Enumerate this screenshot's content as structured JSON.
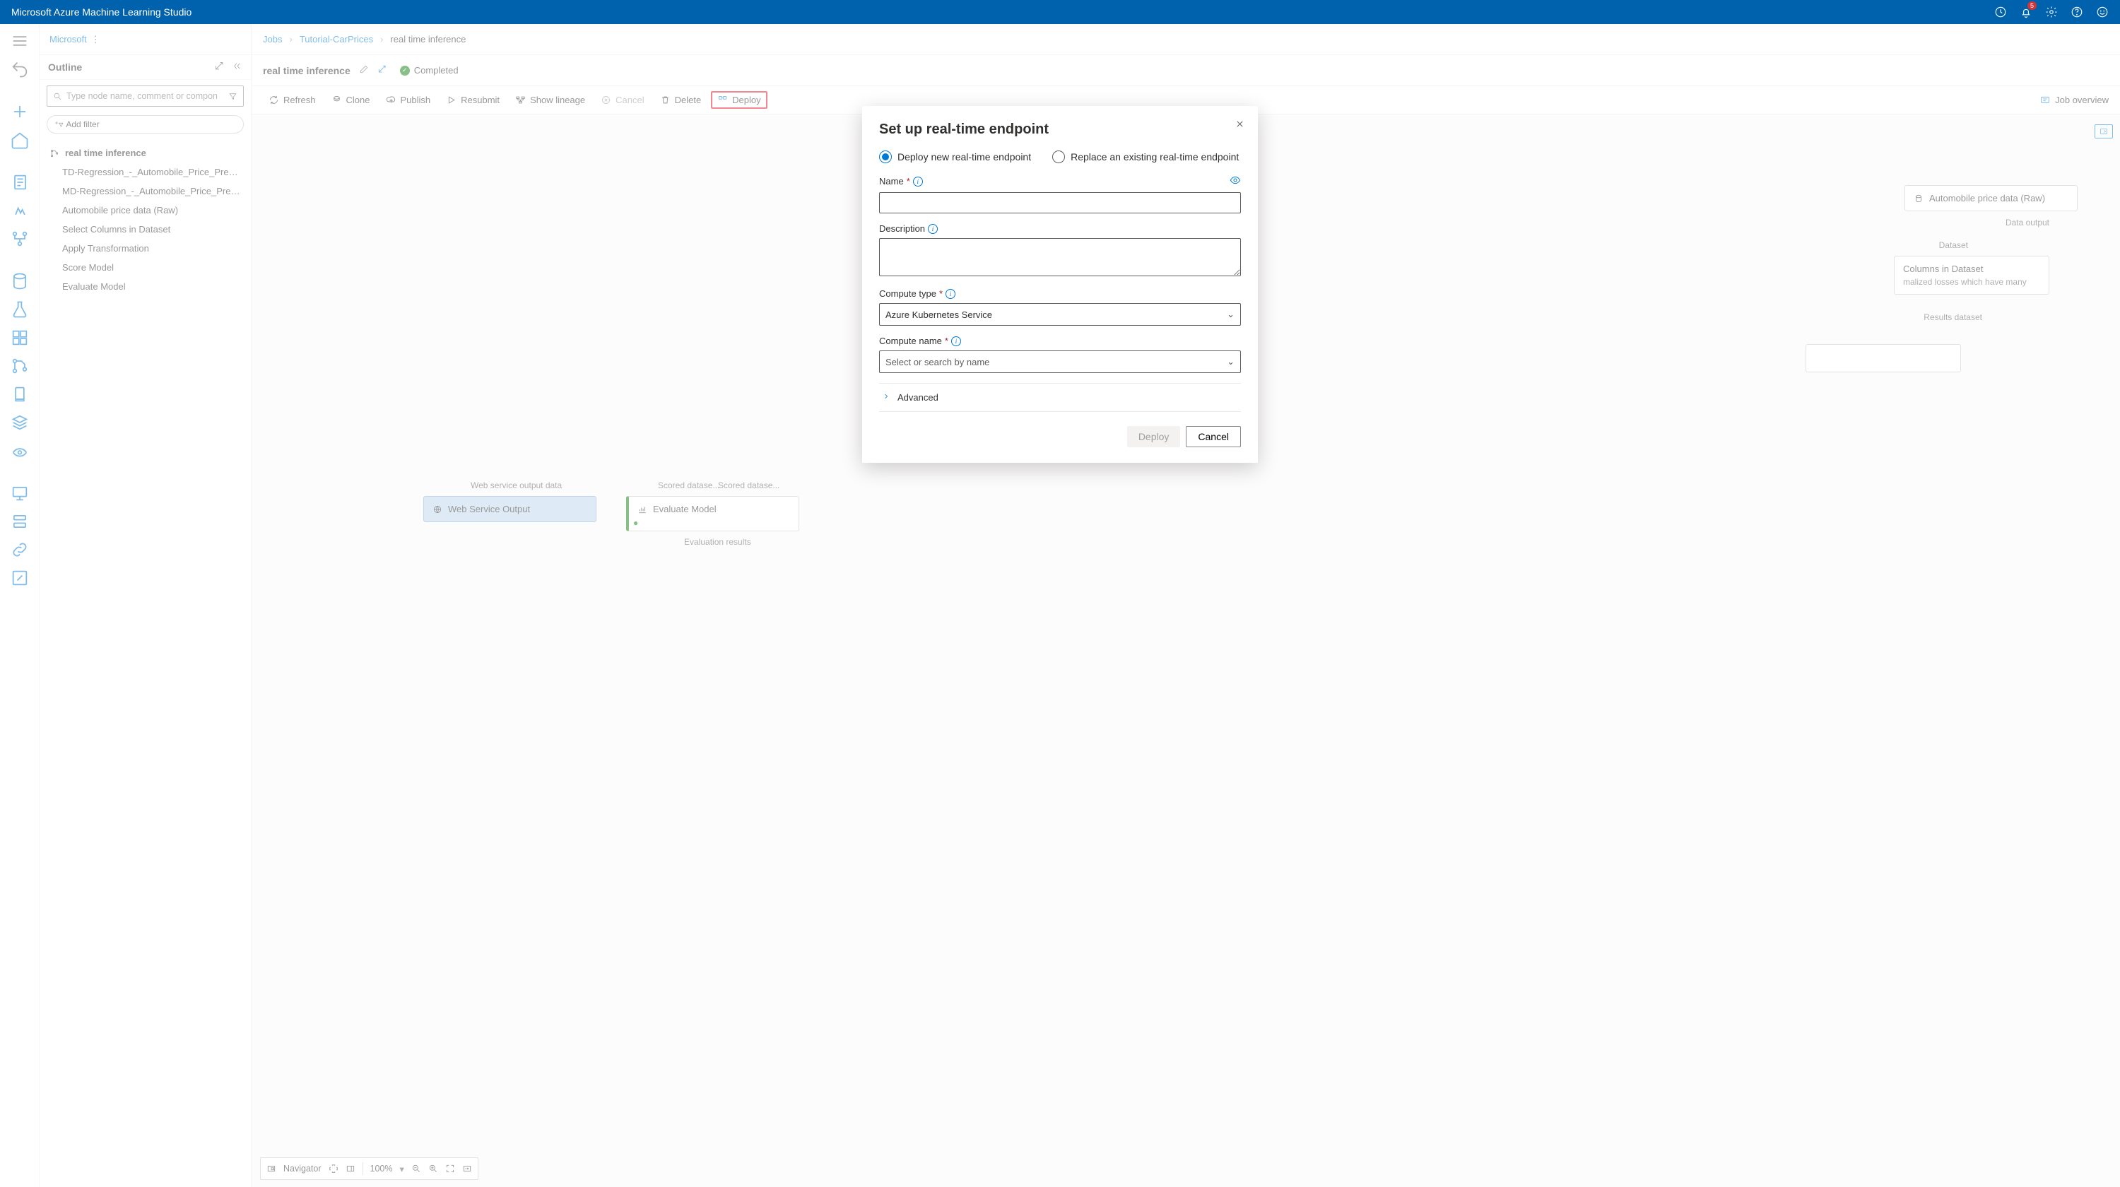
{
  "app_title": "Microsoft Azure Machine Learning Studio",
  "notifications_count": "5",
  "breadcrumb_local": {
    "root": "Microsoft",
    "after": " ⋮"
  },
  "outline": {
    "title": "Outline",
    "search_placeholder": "Type node name, comment or compon",
    "add_filter": "Add filter",
    "root": "real time inference",
    "items": [
      "TD-Regression_-_Automobile_Price_Predict...",
      "MD-Regression_-_Automobile_Price_Predic...",
      "Automobile price data (Raw)",
      "Select Columns in Dataset",
      "Apply Transformation",
      "Score Model",
      "Evaluate Model"
    ]
  },
  "main_breadcrumb": {
    "a": "Jobs",
    "b": "Tutorial-CarPrices",
    "c": "real time inference"
  },
  "job": {
    "name": "real time inference",
    "status": "Completed"
  },
  "toolbar": {
    "refresh": "Refresh",
    "clone": "Clone",
    "publish": "Publish",
    "resubmit": "Resubmit",
    "show_lineage": "Show lineage",
    "cancel": "Cancel",
    "delete": "Delete",
    "deploy": "Deploy",
    "overview": "Job overview"
  },
  "canvas": {
    "node_raw": "Automobile price data (Raw)",
    "port_data_output": "Data output",
    "port_dataset": "Dataset",
    "node_select": {
      "title": "Columns in Dataset",
      "desc": "malized losses which have many"
    },
    "port_results_dataset": "Results dataset",
    "port_wso": "Web service output data",
    "port_scored1": "Scored datase...",
    "port_scored2": "Scored datase...",
    "node_wso": "Web Service Output",
    "node_eval": "Evaluate Model",
    "port_eval_results": "Evaluation results"
  },
  "mini": {
    "nav": "Navigator",
    "zoom": "100%"
  },
  "modal": {
    "title": "Set up real-time endpoint",
    "opt_new": "Deploy new real-time endpoint",
    "opt_replace": "Replace an existing real-time endpoint",
    "label_name": "Name",
    "label_desc": "Description",
    "label_compute_type": "Compute type",
    "compute_type_value": "Azure Kubernetes Service",
    "label_compute_name": "Compute name",
    "compute_name_placeholder": "Select or search by name",
    "advanced": "Advanced",
    "deploy": "Deploy",
    "cancel": "Cancel"
  }
}
